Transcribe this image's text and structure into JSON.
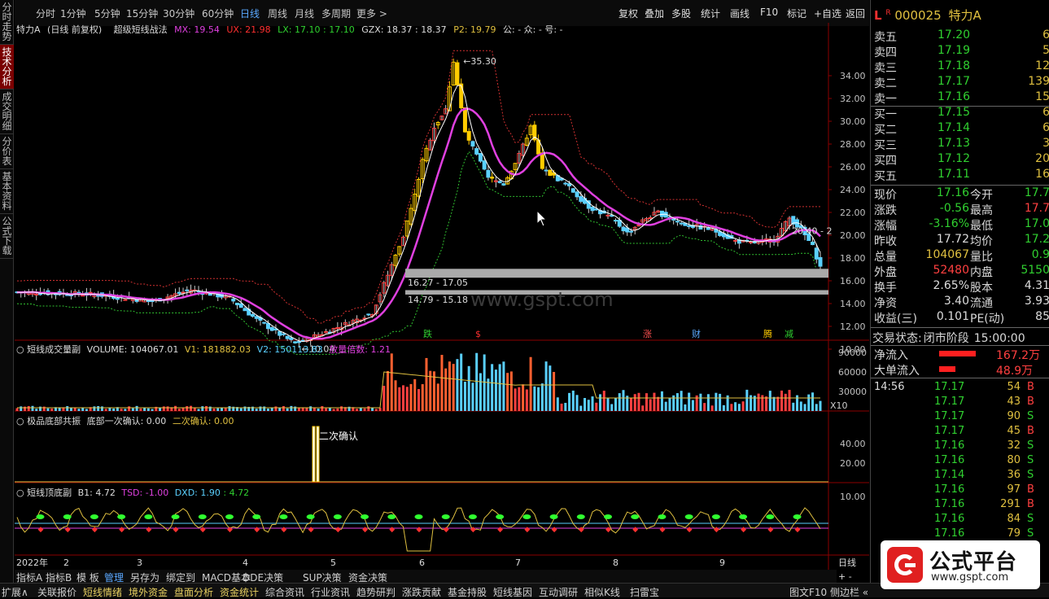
{
  "left_tabs": [
    "分时走势",
    "技术分析",
    "成交明细",
    "分价表",
    "基本资料",
    "公式下载"
  ],
  "top_tabs": [
    "分时",
    "1分钟",
    "5分钟",
    "15分钟",
    "30分钟",
    "60分钟",
    "日线",
    "周线",
    "月线",
    "多周期",
    "更多 >"
  ],
  "top_right": [
    "复权",
    "叠加",
    "多股",
    "统计",
    "画线",
    "F10",
    "标记",
    "+自选",
    "返回"
  ],
  "legend": {
    "stock": "特力A",
    "mode": "(日线 前复权)",
    "formula": "超级短线战法",
    "mx": "MX: 19.54",
    "ux": "UX: 21.98",
    "lx": "LX: 17.10 : 17.10",
    "gzx": "GZX: 18.37 : 18.37",
    "p2": "P2: 19.79",
    "misc": "公: -  众: -  号: -"
  },
  "price_axis": [
    "34.00",
    "32.00",
    "30.00",
    "28.00",
    "26.00",
    "24.00",
    "22.00",
    "20.00",
    "18.00",
    "16.00",
    "14.00",
    "12.00",
    "10.00"
  ],
  "annotations": {
    "high": "35.30",
    "low": "10.04",
    "box1": "16.27 - 17.05",
    "box2": "14.79 - 15.18",
    "right_label": "20.40 - 2",
    "watermark": "www.gspt.com"
  },
  "event_labels": [
    {
      "t": "跌",
      "c": "#30d030"
    },
    {
      "t": "$",
      "c": "#ff3030"
    },
    {
      "t": "涨",
      "c": "#ff5050"
    },
    {
      "t": "财",
      "c": "#5aa8ff"
    },
    {
      "t": "腾",
      "c": "#ffcc00"
    },
    {
      "t": "减",
      "c": "#30d030"
    }
  ],
  "volume_panel": {
    "title": "短线成交量副",
    "volume": "VOLUME: 104067.01",
    "v1": "V1: 181882.03",
    "v2": "V2: 150113.83",
    "ratio": "放量倍数: 1.21",
    "axis": [
      "90000",
      "60000",
      "30000"
    ],
    "unit": "X10"
  },
  "bottom_panel1": {
    "title": "极品底部共振",
    "c1": "底部一次确认: 0.00",
    "c2": "二次确认: 0.00",
    "note": "二次确认",
    "axis": [
      "40.00",
      "20.00"
    ]
  },
  "bottom_panel2": {
    "title": "短线顶底副",
    "b1": "B1: 4.72",
    "tsd": "TSD: -1.00",
    "dxd": "DXD: 1.90",
    "v4": ": 4.72",
    "axis": [
      "10.00"
    ]
  },
  "time_axis": {
    "year": "2022年",
    "months": [
      "2",
      "3",
      "4",
      "5",
      "6",
      "7",
      "8",
      "9"
    ],
    "period": "日线"
  },
  "ind_tabs": [
    "指标A",
    "指标B",
    "模 板",
    "管理",
    "另存为",
    "绑定到",
    "MACD基本",
    "DDE决策",
    "SUP决策",
    "资金决策"
  ],
  "stock_header": {
    "flag": "L",
    "flag2": "R",
    "code": "000025",
    "name": "特力A"
  },
  "orderbook": [
    {
      "l": "卖五",
      "p": "17.20",
      "v": "6"
    },
    {
      "l": "卖四",
      "p": "17.19",
      "v": "5"
    },
    {
      "l": "卖三",
      "p": "17.18",
      "v": "12"
    },
    {
      "l": "卖二",
      "p": "17.17",
      "v": "139"
    },
    {
      "l": "卖一",
      "p": "17.16",
      "v": "15"
    },
    {
      "l": "买一",
      "p": "17.15",
      "v": "6"
    },
    {
      "l": "买二",
      "p": "17.14",
      "v": "6"
    },
    {
      "l": "买三",
      "p": "17.13",
      "v": "3"
    },
    {
      "l": "买四",
      "p": "17.12",
      "v": "20"
    },
    {
      "l": "买五",
      "p": "17.11",
      "v": "16"
    }
  ],
  "quote": [
    {
      "a": "现价",
      "av": "17.16",
      "ac": "#30d030",
      "b": "今开",
      "bv": "17.7",
      "bc": "#30d030"
    },
    {
      "a": "涨跌",
      "av": "-0.56",
      "ac": "#30d030",
      "b": "最高",
      "bv": "17.7",
      "bc": "#ff4040"
    },
    {
      "a": "涨幅",
      "av": "-3.16%",
      "ac": "#30d030",
      "b": "最低",
      "bv": "17.0",
      "bc": "#30d030"
    },
    {
      "a": "昨收",
      "av": "17.72",
      "ac": "#ddd",
      "b": "均价",
      "bv": "17.2",
      "bc": "#30d030"
    },
    {
      "a": "总量",
      "av": "104067",
      "ac": "#e0c040",
      "b": "量比",
      "bv": "0.9",
      "bc": "#30d030"
    },
    {
      "a": "外盘",
      "av": "52480",
      "ac": "#ff4040",
      "b": "内盘",
      "bv": "5150",
      "bc": "#30d030"
    },
    {
      "a": "换手",
      "av": "2.65%",
      "ac": "#ddd",
      "b": "股本",
      "bv": "4.31",
      "bc": "#ddd"
    },
    {
      "a": "净资",
      "av": "3.40",
      "ac": "#ddd",
      "b": "流通",
      "bv": "3.93",
      "bc": "#ddd"
    },
    {
      "a": "收益(三)",
      "av": "0.101",
      "ac": "#ddd",
      "b": "PE(动)",
      "bv": "85",
      "bc": "#ddd"
    }
  ],
  "trade_status": {
    "label": "交易状态:",
    "status": "闭市阶段",
    "time": "15:00:00"
  },
  "flows": [
    {
      "label": "净流入",
      "value": "167.2万",
      "bar": 0.45
    },
    {
      "label": "大单流入",
      "value": "48.9万",
      "bar": 0.2
    }
  ],
  "ticks": [
    {
      "t": "14:56",
      "p": "17.17",
      "v": "54",
      "s": "B"
    },
    {
      "t": "",
      "p": "17.17",
      "v": "43",
      "s": "B"
    },
    {
      "t": "",
      "p": "17.17",
      "v": "90",
      "s": "S"
    },
    {
      "t": "",
      "p": "17.17",
      "v": "45",
      "s": "B"
    },
    {
      "t": "",
      "p": "17.16",
      "v": "32",
      "s": "S"
    },
    {
      "t": "",
      "p": "17.16",
      "v": "80",
      "s": "S"
    },
    {
      "t": "",
      "p": "17.14",
      "v": "36",
      "s": "S"
    },
    {
      "t": "",
      "p": "17.16",
      "v": "97",
      "s": "B"
    },
    {
      "t": "",
      "p": "17.16",
      "v": "291",
      "s": "B"
    },
    {
      "t": "",
      "p": "17.16",
      "v": "84",
      "s": "S"
    },
    {
      "t": "",
      "p": "17.16",
      "v": "79",
      "s": "S"
    }
  ],
  "bottom_bar": [
    "扩展∧",
    "关联报价",
    "短线情绪",
    "境外资金",
    "盘面分析",
    "资金统计",
    "综合资讯",
    "行业资讯",
    "趋势研判",
    "涨跌贡献",
    "基金持股",
    "短线基因",
    "互动调研",
    "相似K线",
    "扫雷宝"
  ],
  "bottom_right": "图文F10 侧边栏 «",
  "logo": {
    "name": "公式平台",
    "url": "www.gspt.com"
  }
}
